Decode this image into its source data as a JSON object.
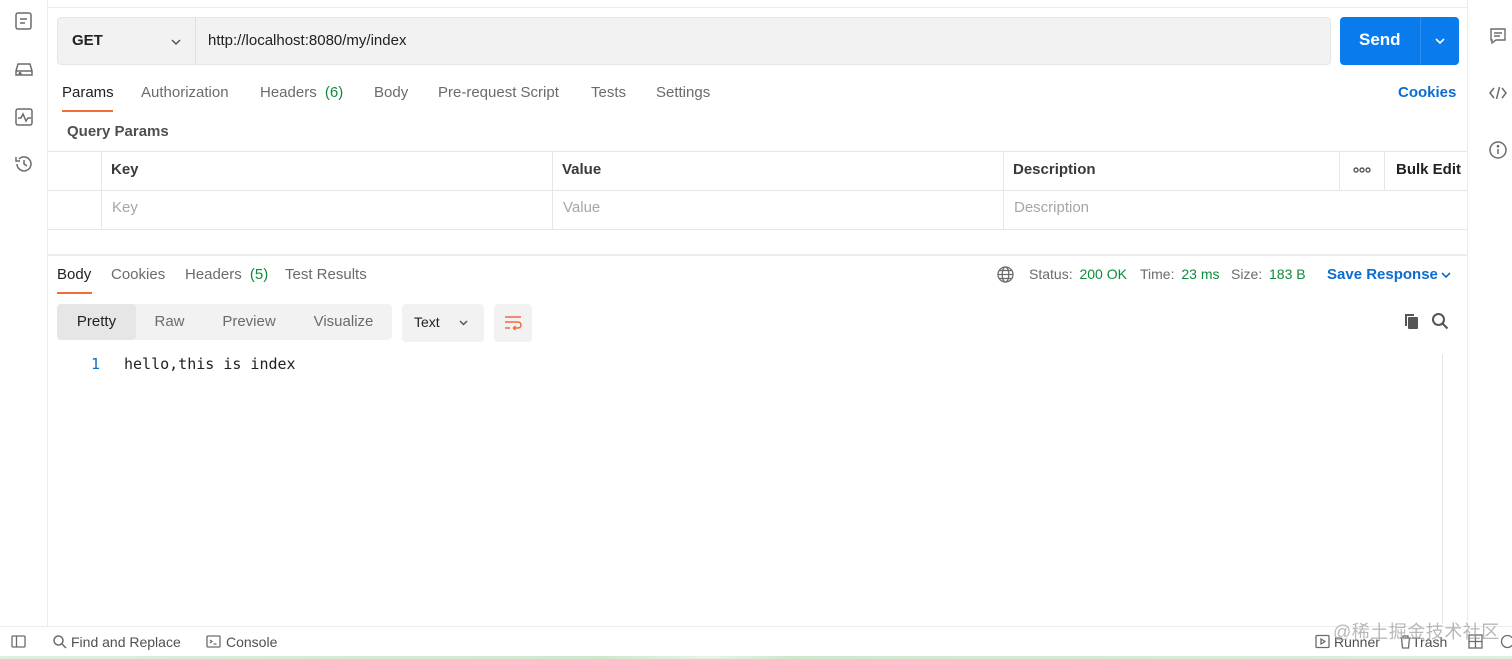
{
  "request": {
    "method": "GET",
    "url": "http://localhost:8080/my/index",
    "send_label": "Send"
  },
  "request_tabs": {
    "params": "Params",
    "authorization": "Authorization",
    "headers": "Headers",
    "headers_count": "(6)",
    "body": "Body",
    "pre_request": "Pre-request Script",
    "tests": "Tests",
    "settings": "Settings",
    "cookies": "Cookies"
  },
  "query_params": {
    "title": "Query Params",
    "columns": {
      "key": "Key",
      "value": "Value",
      "description": "Description"
    },
    "bulk_edit": "Bulk Edit",
    "placeholders": {
      "key": "Key",
      "value": "Value",
      "description": "Description"
    }
  },
  "response_tabs": {
    "body": "Body",
    "cookies": "Cookies",
    "headers": "Headers",
    "headers_count": "(5)",
    "test_results": "Test Results"
  },
  "response_meta": {
    "status_label": "Status:",
    "status_value": "200 OK",
    "time_label": "Time:",
    "time_value": "23 ms",
    "size_label": "Size:",
    "size_value": "183 B",
    "save_response": "Save Response"
  },
  "view_modes": [
    "Pretty",
    "Raw",
    "Preview",
    "Visualize"
  ],
  "format": "Text",
  "response_body": [
    {
      "line": "1",
      "text": "hello,this is index"
    }
  ],
  "footer": {
    "find_replace": "Find and Replace",
    "console": "Console",
    "runner": "Runner",
    "trash": "Trash"
  },
  "watermark": "@稀土掘金技术社区",
  "colors": {
    "accent_blue": "#097bed",
    "active_tab_underline": "#f26b3a",
    "success_green": "#0f8a3c",
    "link_blue": "#0c6ccf"
  },
  "icons": [
    "new-request-icon",
    "environments-icon",
    "monitor-icon",
    "history-icon",
    "comments-icon",
    "code-icon",
    "info-icon",
    "globe-icon",
    "copy-icon",
    "search-icon",
    "wrap-lines-icon"
  ]
}
